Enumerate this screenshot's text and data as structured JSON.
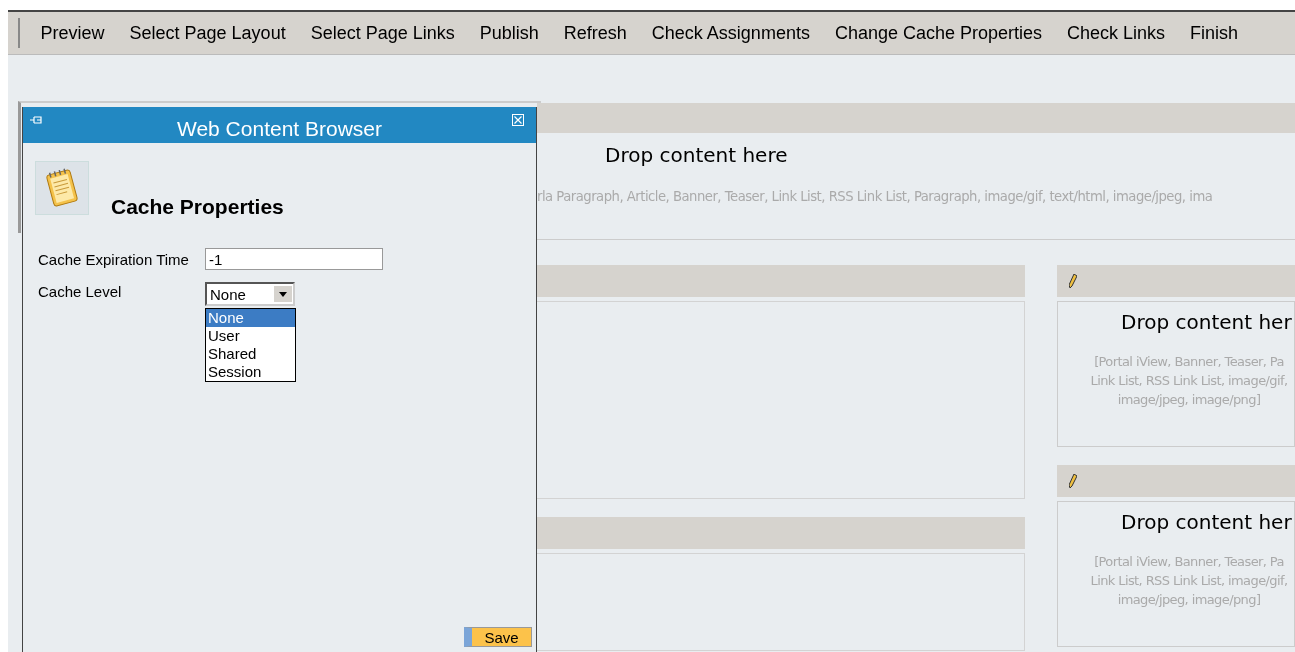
{
  "toolbar": {
    "items": [
      "Preview",
      "Select Page Layout",
      "Select Page Links",
      "Publish",
      "Refresh",
      "Check Assignments",
      "Change Cache Properties",
      "Check Links",
      "Finish"
    ]
  },
  "top_zone": {
    "title": "Drop content here",
    "accepts": "rla Paragraph, Article, Banner, Teaser, Link List, RSS Link List, Paragraph, image/gif, text/html, image/jpeg, ima"
  },
  "right_zones": [
    {
      "title": "Drop content her",
      "lines": [
        "[Portal iView, Banner, Teaser, Pa",
        "Link List, RSS Link List, image/gif,",
        "image/jpeg, image/png]"
      ]
    },
    {
      "title": "Drop content her",
      "lines": [
        "[Portal iView, Banner, Teaser, Pa",
        "Link List, RSS Link List, image/gif,",
        "image/jpeg, image/png]"
      ]
    }
  ],
  "dialog": {
    "title": "Web Content Browser",
    "heading": "Cache Properties",
    "fields": [
      {
        "kind": "text",
        "label": "Cache Expiration Time",
        "value": "-1"
      },
      {
        "kind": "select",
        "label": "Cache Level",
        "value": "None",
        "expanded": true,
        "options": [
          {
            "label": "None",
            "selected": true
          },
          {
            "label": "User",
            "selected": false
          },
          {
            "label": "Shared",
            "selected": false
          },
          {
            "label": "Session",
            "selected": false
          }
        ]
      }
    ],
    "save_button": "Save"
  }
}
